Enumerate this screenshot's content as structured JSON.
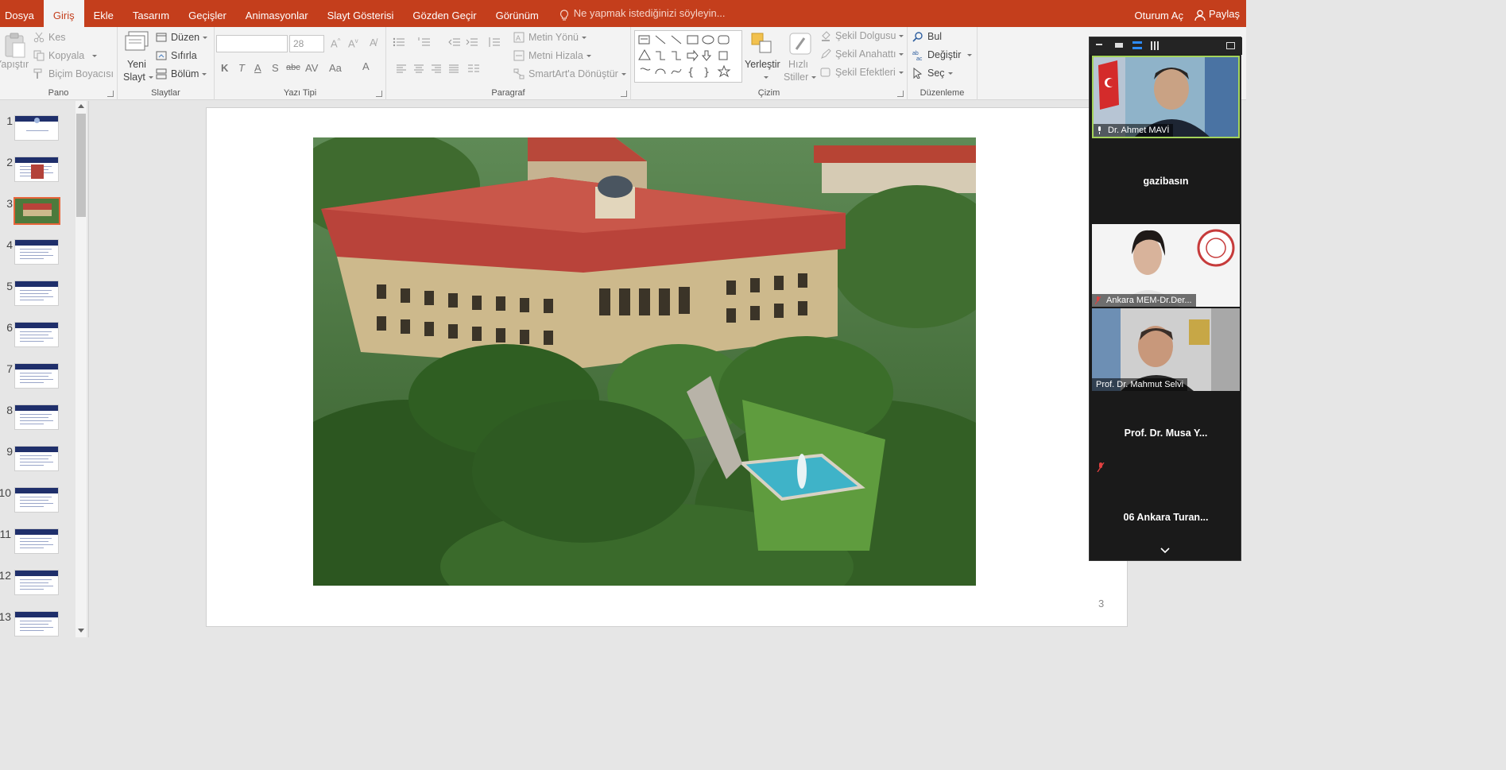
{
  "menu": {
    "tabs": [
      "Dosya",
      "Giriş",
      "Ekle",
      "Tasarım",
      "Geçişler",
      "Animasyonlar",
      "Slayt Gösterisi",
      "Gözden Geçir",
      "Görünüm"
    ],
    "active_index": 1,
    "tell_me": "Ne yapmak istediğinizi söyleyin...",
    "sign_in": "Oturum Aç",
    "share": "Paylaş"
  },
  "ribbon": {
    "pano": {
      "label": "Pano",
      "paste": "Yapıştır",
      "cut": "Kes",
      "copy": "Kopyala",
      "format_painter": "Biçim Boyacısı"
    },
    "slaytlar": {
      "label": "Slaytlar",
      "new_slide_1": "Yeni",
      "new_slide_2": "Slayt",
      "layout": "Düzen",
      "reset": "Sıfırla",
      "section": "Bölüm"
    },
    "yazi_tipi": {
      "label": "Yazı Tipi",
      "font_size": "28"
    },
    "paragraf": {
      "label": "Paragraf",
      "text_direction": "Metin Yönü",
      "align_text": "Metni Hizala",
      "smartart": "SmartArt'a Dönüştür"
    },
    "cizim": {
      "label": "Çizim",
      "arrange": "Yerleştir",
      "quick_styles_1": "Hızlı",
      "quick_styles_2": "Stiller",
      "shape_fill": "Şekil Dolgusu",
      "shape_outline": "Şekil Anahattı",
      "shape_effects": "Şekil Efektleri"
    },
    "duzenleme": {
      "label": "Düzenleme",
      "find": "Bul",
      "replace": "Değiştir",
      "select": "Seç"
    }
  },
  "thumbnails": {
    "numbers": [
      "1",
      "2",
      "3",
      "4",
      "5",
      "6",
      "7",
      "8",
      "9",
      "10",
      "11",
      "12",
      "13"
    ],
    "selected": 3
  },
  "slide": {
    "number": "3"
  },
  "video_panel": {
    "participants": [
      {
        "name": "Dr. Ahmet MAVİ"
      },
      {
        "name": "gazibasın"
      },
      {
        "name": "Ankara MEM-Dr.Der..."
      },
      {
        "name": "Prof. Dr. Mahmut Selvi"
      },
      {
        "name": "Prof. Dr. Musa Y..."
      },
      {
        "name": "06 Ankara Turan..."
      }
    ]
  },
  "colors": {
    "accent": "#c43e1c",
    "selected_thumb": "#e8643a"
  }
}
